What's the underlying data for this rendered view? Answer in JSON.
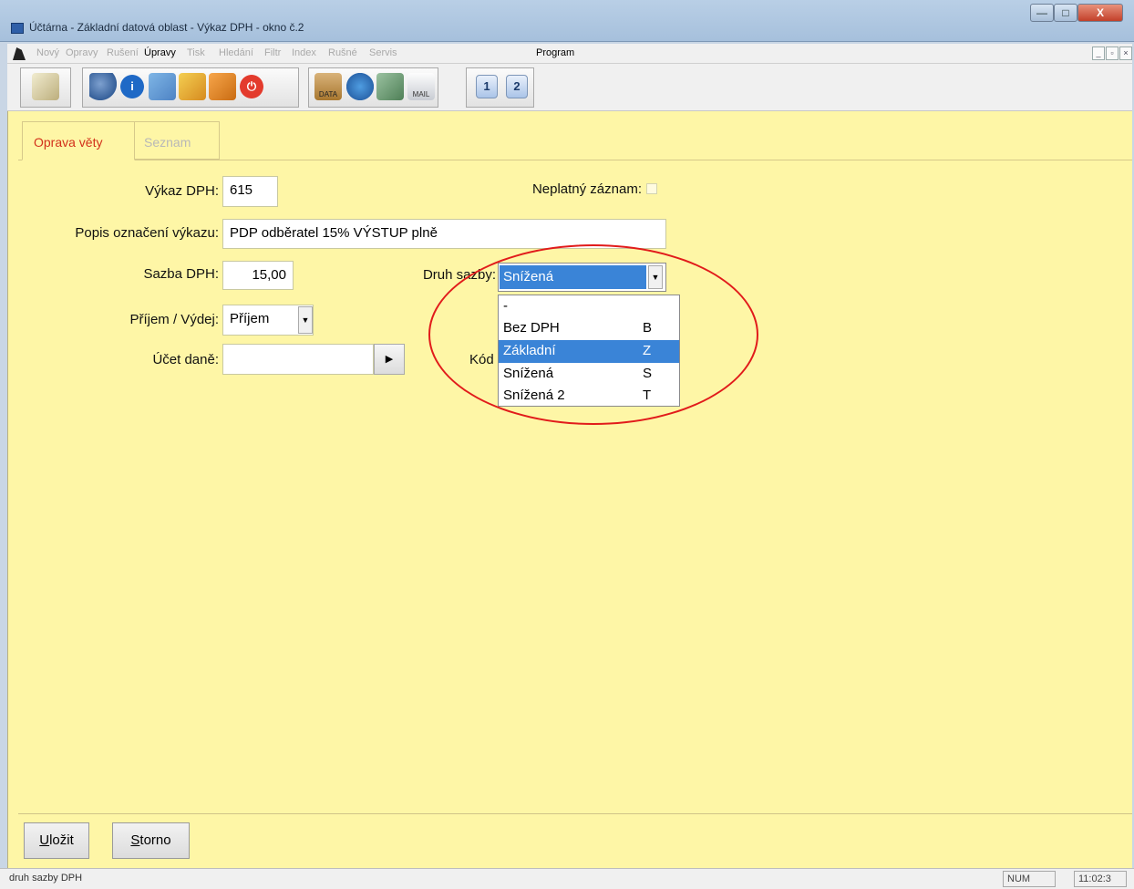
{
  "window": {
    "title": "Účtárna - Základní datová oblast - Výkaz DPH - okno č.2"
  },
  "menu": {
    "items": [
      {
        "label": "Nový",
        "enabled": false
      },
      {
        "label": "Opravy",
        "enabled": false
      },
      {
        "label": "Rušení",
        "enabled": false
      },
      {
        "label": "Úpravy",
        "enabled": true
      },
      {
        "label": "Tisk",
        "enabled": false
      },
      {
        "label": "Hledání",
        "enabled": false
      },
      {
        "label": "Filtr",
        "enabled": false
      },
      {
        "label": "Index",
        "enabled": false
      },
      {
        "label": "Rušné",
        "enabled": false
      },
      {
        "label": "Servis",
        "enabled": false
      },
      {
        "label": "Program",
        "enabled": true
      }
    ]
  },
  "toolbar": {
    "icons": [
      "edit-pen-icon",
      "search-icon",
      "info-icon",
      "copy-icon",
      "pencil-icon",
      "folder-icon",
      "power-icon",
      "data-icon",
      "settings-icon",
      "image-icon",
      "mail-icon",
      "window-1-icon",
      "window-2-icon"
    ],
    "window_buttons": [
      "1",
      "2"
    ],
    "data_label": "DATA",
    "mail_label": "MAIL"
  },
  "tabs": [
    {
      "label": "Oprava věty",
      "active": true
    },
    {
      "label": "Seznam",
      "active": false
    }
  ],
  "form": {
    "vykaz_label": "Výkaz DPH:",
    "vykaz_value": "615",
    "neplatny_label": "Neplatný záznam:",
    "popis_label": "Popis označení výkazu:",
    "popis_value": "PDP odběratel 15% VÝSTUP plně",
    "sazba_label": "Sazba DPH:",
    "sazba_value": "15,00",
    "druh_label": "Druh sazby:",
    "druh_value": "Snížená",
    "prijem_label": "Příjem / Výdej:",
    "prijem_value": "Příjem",
    "ucet_label": "Účet daně:",
    "ucet_value": "",
    "kod_label": "Kód"
  },
  "dropdown": {
    "options": [
      {
        "name": "-",
        "code": ""
      },
      {
        "name": "Bez DPH",
        "code": "B"
      },
      {
        "name": "Základní",
        "code": "Z",
        "highlighted": true
      },
      {
        "name": "Snížená",
        "code": "S"
      },
      {
        "name": "Snížená 2",
        "code": "T"
      }
    ]
  },
  "buttons": {
    "ulozit_first": "U",
    "ulozit_rest": "ložit",
    "storno_first": "S",
    "storno_rest": "torno"
  },
  "status": {
    "text": "druh sazby DPH",
    "num": "NUM",
    "time": "11:02:3"
  },
  "colors": {
    "panel": "#fef6a6",
    "selection": "#3a84d7",
    "annotation": "#e11b1b",
    "active_tab": "#d2301b"
  }
}
